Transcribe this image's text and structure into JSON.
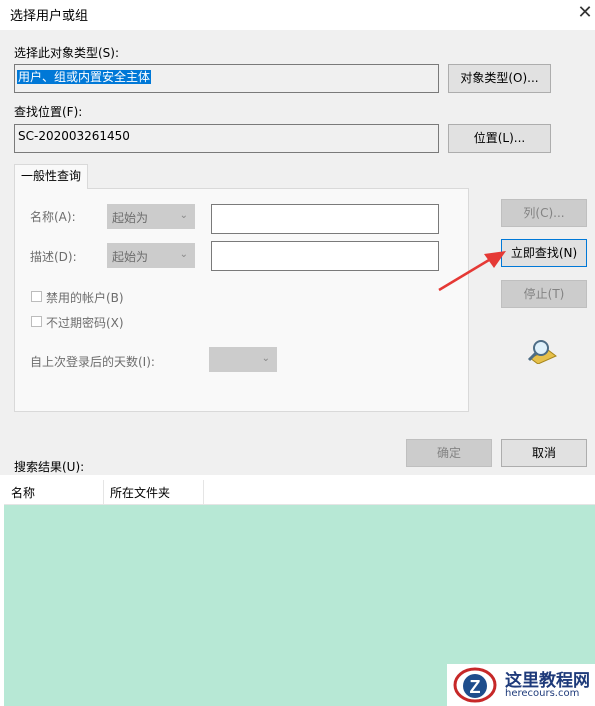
{
  "window": {
    "title": "选择用户或组",
    "close_glyph": "✕"
  },
  "object_type": {
    "label": "选择此对象类型(S):",
    "value": "用户、组或内置安全主体",
    "button": "对象类型(O)..."
  },
  "location": {
    "label": "查找位置(F):",
    "value": "SC-202003261450",
    "button": "位置(L)..."
  },
  "tab": {
    "label": "一般性查询"
  },
  "query": {
    "name_label": "名称(A):",
    "name_mode": "起始为",
    "name_value": "",
    "desc_label": "描述(D):",
    "desc_mode": "起始为",
    "desc_value": "",
    "disabled_accounts": {
      "label": "禁用的帐户(B)",
      "checked": false
    },
    "non_expiring": {
      "label": "不过期密码(X)",
      "checked": false
    },
    "days_label": "自上次登录后的天数(I):",
    "days_value": ""
  },
  "side_buttons": {
    "columns": "列(C)...",
    "find_now": "立即查找(N)",
    "stop": "停止(T)"
  },
  "footer": {
    "ok": "确定",
    "cancel": "取消"
  },
  "results": {
    "label": "搜索结果(U):",
    "columns": [
      "名称",
      "所在文件夹"
    ]
  },
  "watermark": {
    "name": "这里教程网",
    "url": "herecours.com"
  },
  "colors": {
    "accent": "#0078d7",
    "results_bg": "#b7e8d5",
    "arrow": "#e53935",
    "dialog_bg": "#f0f0f0"
  }
}
